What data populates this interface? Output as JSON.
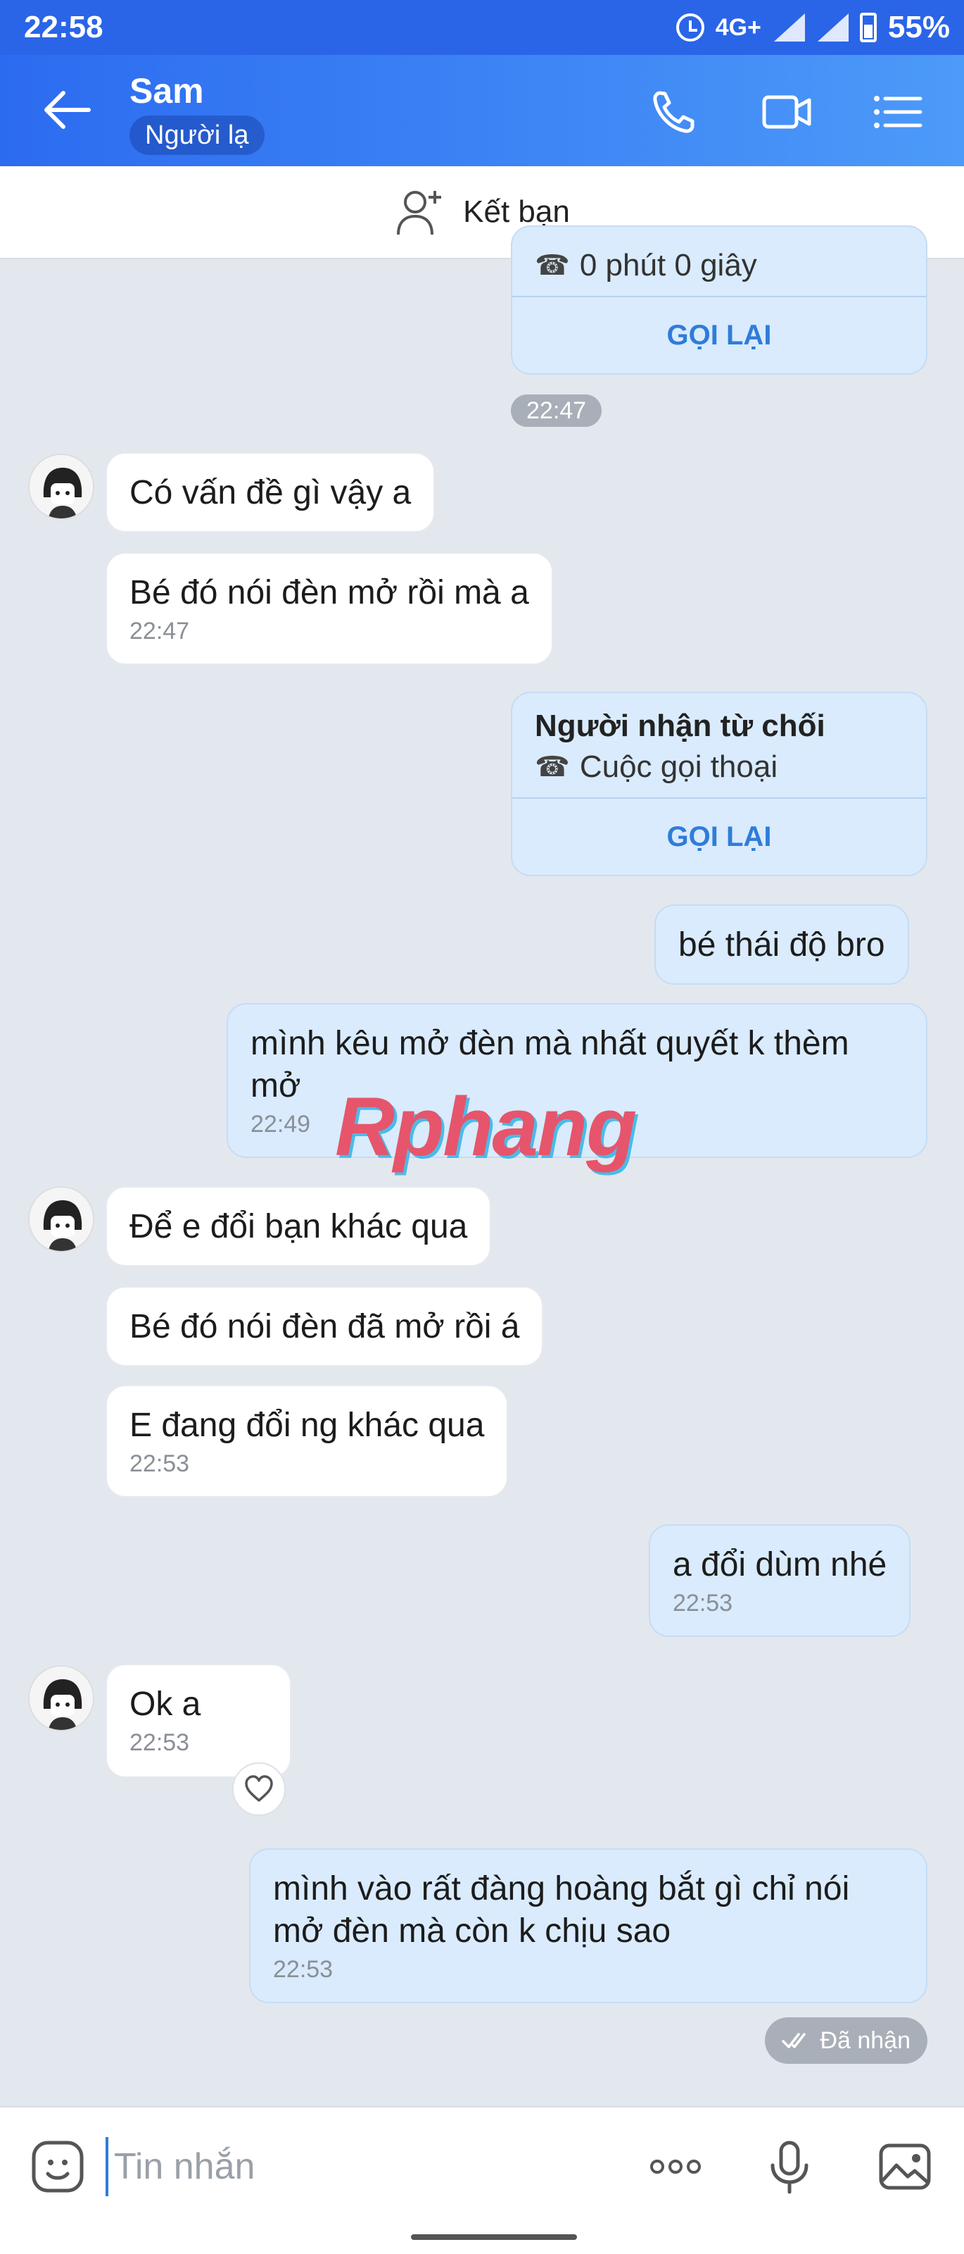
{
  "status_bar": {
    "time": "22:58",
    "network": "4G+",
    "battery": "55%"
  },
  "header": {
    "contact_name": "Sam",
    "badge": "Người lạ",
    "icons": [
      "back-arrow-icon",
      "phone-icon",
      "video-camera-icon",
      "menu-list-icon"
    ]
  },
  "add_friend": {
    "label": "Kết bạn"
  },
  "call_cards": [
    {
      "sub": "0 phút 0 giây",
      "callback": "GỌI LẠI"
    },
    {
      "title": "Người nhận từ chối",
      "sub": "Cuộc gọi thoại",
      "callback": "GỌI LẠI"
    }
  ],
  "time_chip": "22:47",
  "messages": [
    {
      "side": "in",
      "text": "Có vấn đề gì vậy a"
    },
    {
      "side": "in",
      "text": "Bé đó nói đèn mở rồi mà a",
      "time": "22:47"
    },
    {
      "side": "out",
      "text": "bé thái độ bro"
    },
    {
      "side": "out",
      "text": "mình kêu mở đèn mà nhất quyết k thèm mở",
      "time": "22:49"
    },
    {
      "side": "in",
      "text": "Để e đổi bạn khác qua"
    },
    {
      "side": "in",
      "text": "Bé đó nói đèn đã mở rồi á"
    },
    {
      "side": "in",
      "text": "E đang đổi ng khác qua",
      "time": "22:53"
    },
    {
      "side": "out",
      "text": "a đổi dùm nhé",
      "time": "22:53"
    },
    {
      "side": "in",
      "text": "Ok a",
      "time": "22:53"
    },
    {
      "side": "out",
      "text": "mình vào rất đàng hoàng bắt gì chỉ nói mở đèn mà còn k chịu sao",
      "time": "22:53"
    }
  ],
  "status": {
    "received": "Đã nhận"
  },
  "watermark": "Rphang",
  "input": {
    "placeholder": "Tin nhắn"
  },
  "colors": {
    "header_start": "#2c6bf0",
    "header_end": "#4c9af9",
    "chat_bg": "#e3e8ef",
    "outgoing_bubble": "#d9ebfd",
    "link_blue": "#2f7cd9"
  }
}
